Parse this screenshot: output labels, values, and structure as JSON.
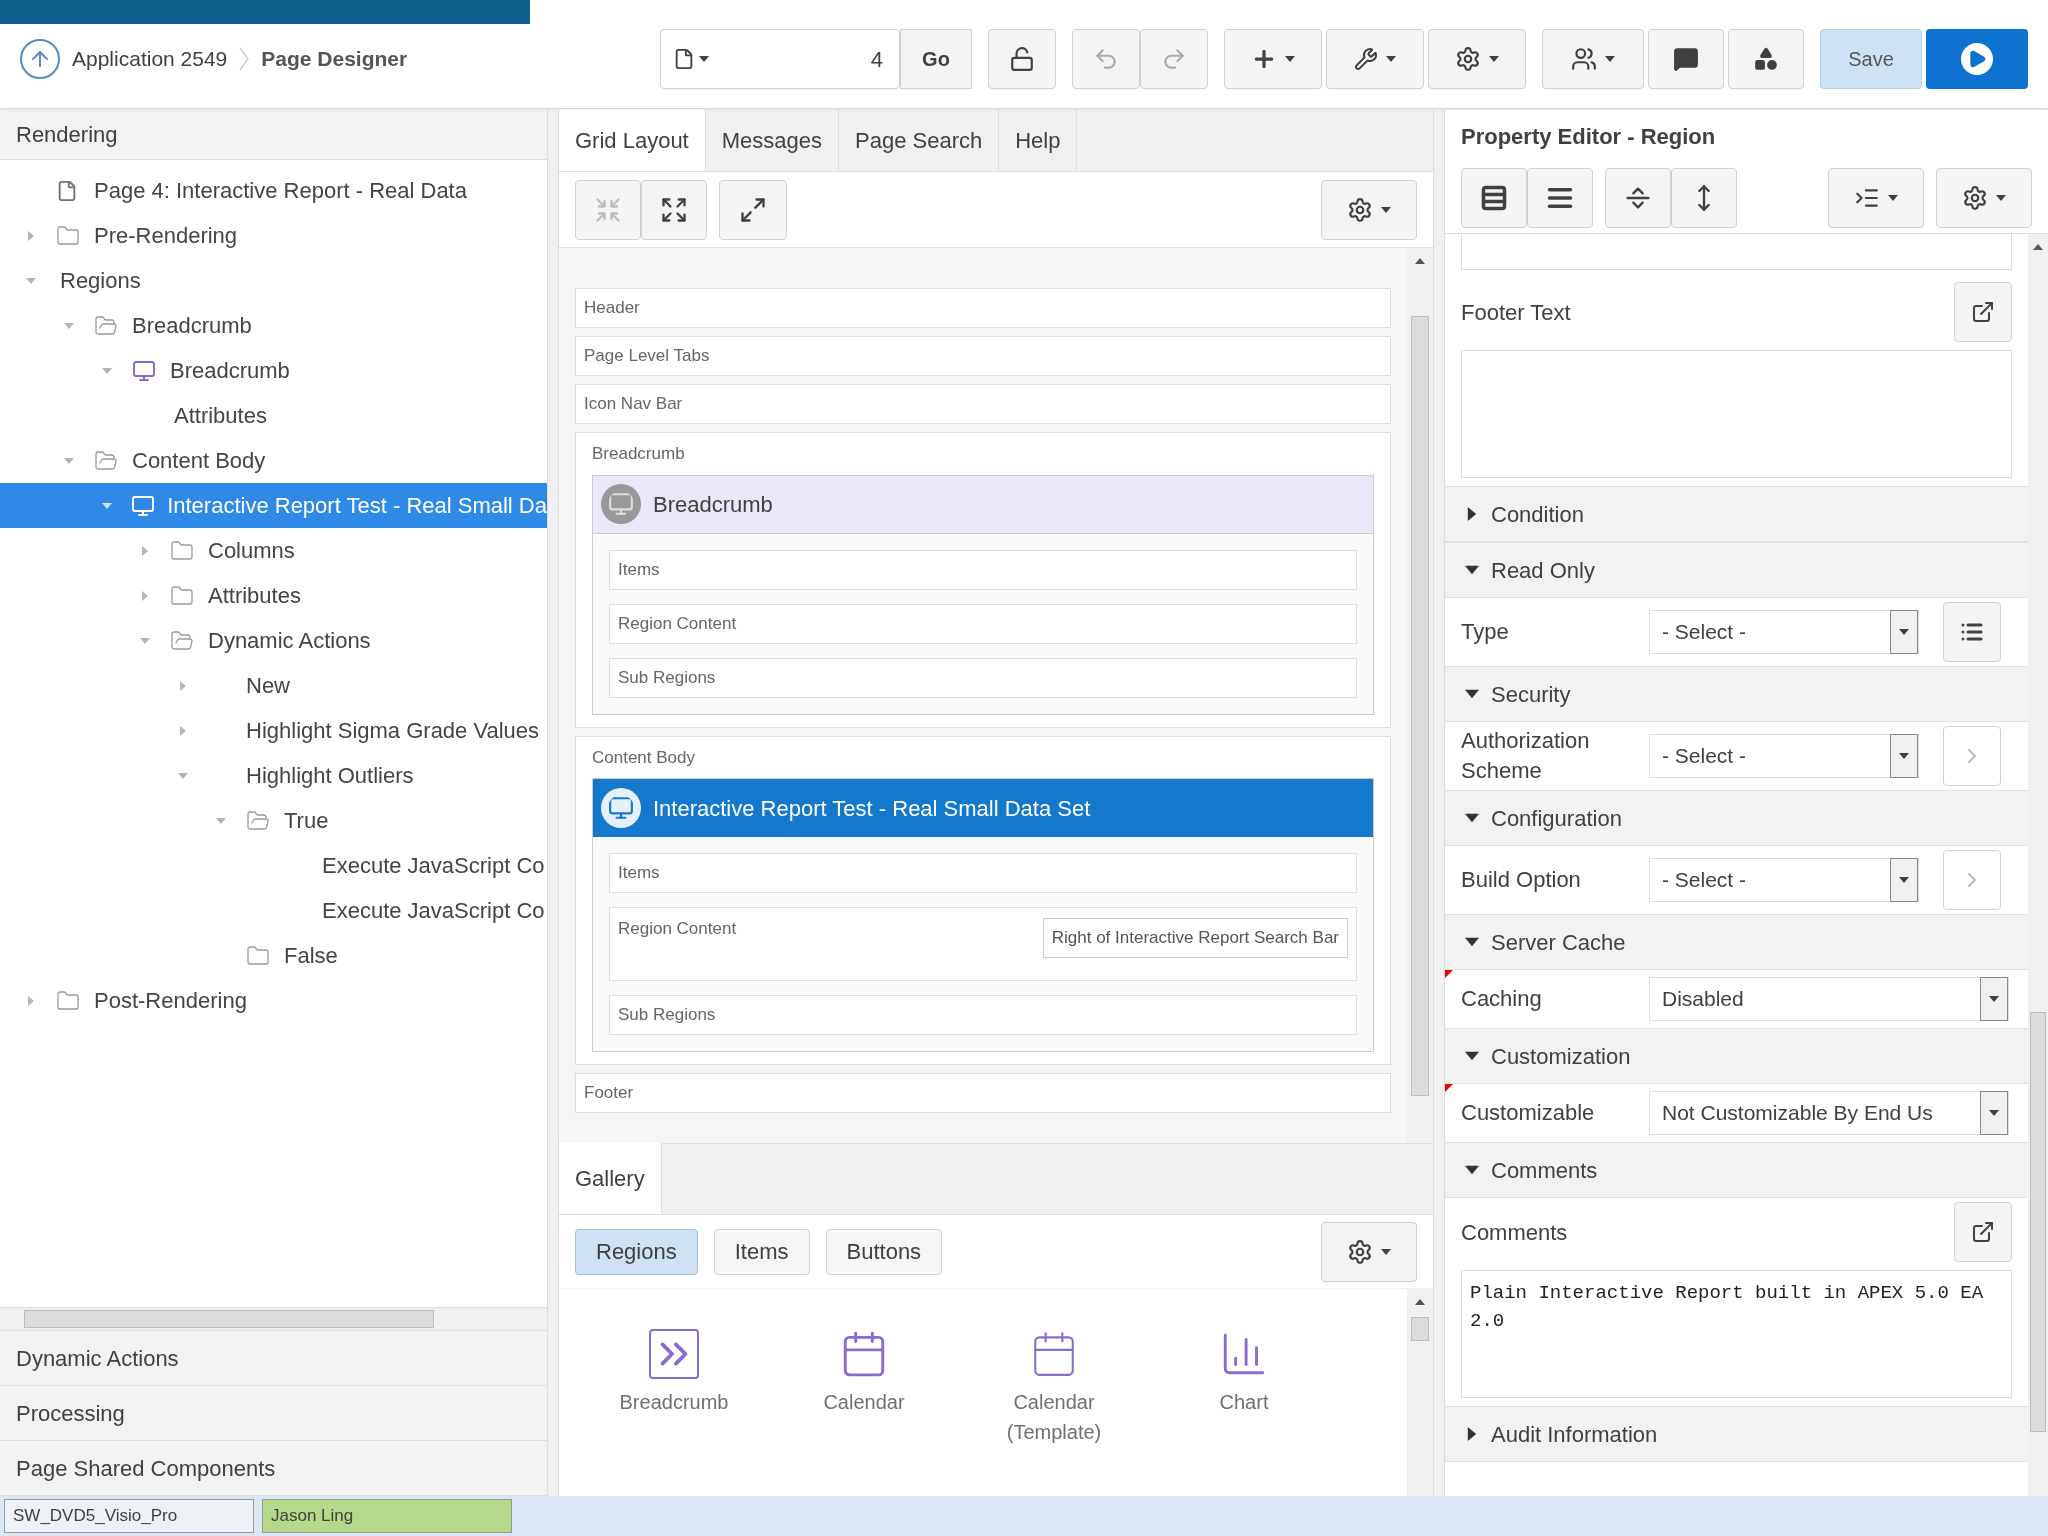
{
  "header": {
    "breadcrumb": [
      "Application 2549",
      "Page Designer"
    ],
    "page_field": {
      "value": "4"
    },
    "go_button": "Go",
    "save_button": "Save"
  },
  "left_panel": {
    "title": "Rendering",
    "tree": [
      {
        "label": "Page 4: Interactive Report - Real Data",
        "kind": "page",
        "selected": false
      },
      {
        "label": "Pre-Rendering",
        "kind": "folder",
        "expanded": false,
        "selected": false
      },
      {
        "label": "Regions",
        "kind": "group",
        "expanded": true,
        "selected": false,
        "children": [
          {
            "label": "Breadcrumb",
            "kind": "folder",
            "expanded": true,
            "selected": false,
            "children": [
              {
                "label": "Breadcrumb",
                "kind": "region",
                "expanded": true,
                "selected": false,
                "children": [
                  {
                    "label": "Attributes",
                    "kind": "leaf",
                    "selected": false
                  }
                ]
              }
            ]
          },
          {
            "label": "Content Body",
            "kind": "folder",
            "expanded": true,
            "selected": false,
            "children": [
              {
                "label": "Interactive Report Test - Real Small Da",
                "kind": "region",
                "expanded": true,
                "selected": true,
                "children": [
                  {
                    "label": "Columns",
                    "kind": "folder",
                    "expanded": false,
                    "selected": false
                  },
                  {
                    "label": "Attributes",
                    "kind": "folder",
                    "expanded": false,
                    "selected": false
                  },
                  {
                    "label": "Dynamic Actions",
                    "kind": "folder",
                    "expanded": true,
                    "selected": false,
                    "children": [
                      {
                        "label": "New",
                        "kind": "action",
                        "expanded": false,
                        "selected": false
                      },
                      {
                        "label": "Highlight Sigma Grade Values",
                        "kind": "action",
                        "expanded": false,
                        "selected": false
                      },
                      {
                        "label": "Highlight Outliers",
                        "kind": "action",
                        "expanded": true,
                        "selected": false,
                        "children": [
                          {
                            "label": "True",
                            "kind": "folder",
                            "expanded": true,
                            "selected": false,
                            "children": [
                              {
                                "label": "Execute JavaScript Co",
                                "kind": "action",
                                "selected": false
                              },
                              {
                                "label": "Execute JavaScript Co",
                                "kind": "action",
                                "selected": false
                              }
                            ]
                          },
                          {
                            "label": "False",
                            "kind": "folder",
                            "selected": false
                          }
                        ]
                      }
                    ]
                  }
                ]
              }
            ]
          }
        ]
      },
      {
        "label": "Post-Rendering",
        "kind": "folder",
        "expanded": false,
        "selected": false
      }
    ],
    "sections": [
      "Dynamic Actions",
      "Processing",
      "Page Shared Components"
    ]
  },
  "center": {
    "tabs": [
      {
        "label": "Grid Layout",
        "selected": true
      },
      {
        "label": "Messages",
        "selected": false
      },
      {
        "label": "Page Search",
        "selected": false
      },
      {
        "label": "Help",
        "selected": false
      }
    ],
    "grid": [
      {
        "kind": "slot",
        "label": "Header"
      },
      {
        "kind": "slot",
        "label": "Page Level Tabs"
      },
      {
        "kind": "slot",
        "label": "Icon Nav Bar"
      },
      {
        "kind": "container",
        "label": "Breadcrumb",
        "region": {
          "title": "Breadcrumb",
          "selected": false,
          "slots": [
            {
              "label": "Items"
            },
            {
              "label": "Region Content"
            },
            {
              "label": "Sub Regions"
            }
          ]
        }
      },
      {
        "kind": "container",
        "label": "Content Body",
        "region": {
          "title": "Interactive Report Test - Real Small Data Set",
          "selected": true,
          "slots": [
            {
              "label": "Items"
            },
            {
              "label": "Region Content",
              "position": "Right of Interactive Report Search Bar"
            },
            {
              "label": "Sub Regions"
            }
          ]
        }
      },
      {
        "kind": "slot",
        "label": "Footer"
      }
    ],
    "gallery": {
      "title": "Gallery",
      "tabs": [
        {
          "label": "Regions",
          "selected": true
        },
        {
          "label": "Items",
          "selected": false
        },
        {
          "label": "Buttons",
          "selected": false
        }
      ],
      "items": [
        {
          "label": "Breadcrumb",
          "kind": "breadcrumb"
        },
        {
          "label": "Calendar",
          "kind": "calendar"
        },
        {
          "label": "Calendar (Template)",
          "kind": "calendar-template"
        },
        {
          "label": "Chart",
          "kind": "chart"
        }
      ]
    }
  },
  "property_editor": {
    "title": "Property Editor - Region",
    "properties": [
      {
        "kind": "textarea",
        "label": "Footer Text"
      },
      {
        "kind": "group",
        "label": "Condition",
        "expanded": false
      },
      {
        "kind": "group",
        "label": "Read Only",
        "expanded": true
      },
      {
        "kind": "select-list",
        "label": "Type",
        "value": "- Select -",
        "changed": false
      },
      {
        "kind": "group",
        "label": "Security",
        "expanded": true
      },
      {
        "kind": "select-link",
        "label": "Authorization Scheme",
        "value": "- Select -",
        "changed": false
      },
      {
        "kind": "group",
        "label": "Configuration",
        "expanded": true
      },
      {
        "kind": "select-link",
        "label": "Build Option",
        "value": "- Select -",
        "changed": false
      },
      {
        "kind": "group",
        "label": "Server Cache",
        "expanded": true
      },
      {
        "kind": "select",
        "label": "Caching",
        "value": "Disabled",
        "changed": true
      },
      {
        "kind": "group",
        "label": "Customization",
        "expanded": true
      },
      {
        "kind": "select",
        "label": "Customizable",
        "value": "Not Customizable By End Us",
        "changed": true
      },
      {
        "kind": "group",
        "label": "Comments",
        "expanded": true
      },
      {
        "kind": "textarea",
        "label": "Comments",
        "value": "Plain Interactive Report built in APEX 5.0 EA 2.0"
      },
      {
        "kind": "group",
        "label": "Audit Information",
        "expanded": false
      }
    ]
  },
  "taskbar": [
    {
      "label": "SW_DVD5_Visio_Pro",
      "selected": false
    },
    {
      "label": "Jason Ling",
      "selected": true
    }
  ]
}
